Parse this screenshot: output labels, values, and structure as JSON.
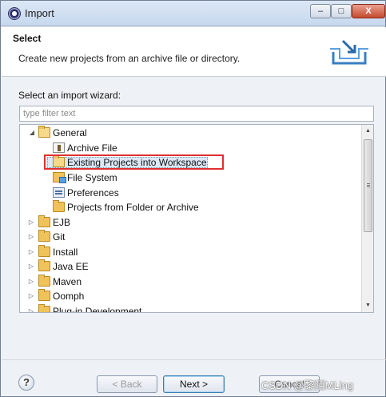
{
  "window": {
    "title": "Import",
    "controls": {
      "minimize": "–",
      "maximize": "□",
      "close": "X"
    }
  },
  "header": {
    "title": "Select",
    "description": "Create new projects from an archive file or directory.",
    "icon": "import-wizard-icon"
  },
  "wizard": {
    "label": "Select an import wizard:",
    "filter_placeholder": "type filter text"
  },
  "tree": {
    "items": [
      {
        "label": "General",
        "expanded": true,
        "icon": "folder-open-icon"
      },
      {
        "label": "Archive File",
        "icon": "archive-icon"
      },
      {
        "label": "Existing Projects into Workspace",
        "icon": "project-folder-icon",
        "selected": true
      },
      {
        "label": "File System",
        "icon": "file-system-icon"
      },
      {
        "label": "Preferences",
        "icon": "preferences-icon"
      },
      {
        "label": "Projects from Folder or Archive",
        "icon": "folder-icon"
      },
      {
        "label": "EJB",
        "icon": "folder-icon"
      },
      {
        "label": "Git",
        "icon": "folder-icon"
      },
      {
        "label": "Install",
        "icon": "folder-icon"
      },
      {
        "label": "Java EE",
        "icon": "folder-icon"
      },
      {
        "label": "Maven",
        "icon": "folder-icon"
      },
      {
        "label": "Oomph",
        "icon": "folder-icon"
      },
      {
        "label": "Plug-in Development",
        "icon": "folder-icon"
      }
    ]
  },
  "footer": {
    "help": "?",
    "back": "< Back",
    "next": "Next >",
    "cancel": "Cancel",
    "watermark": "CSDN @黎陌MLing"
  }
}
